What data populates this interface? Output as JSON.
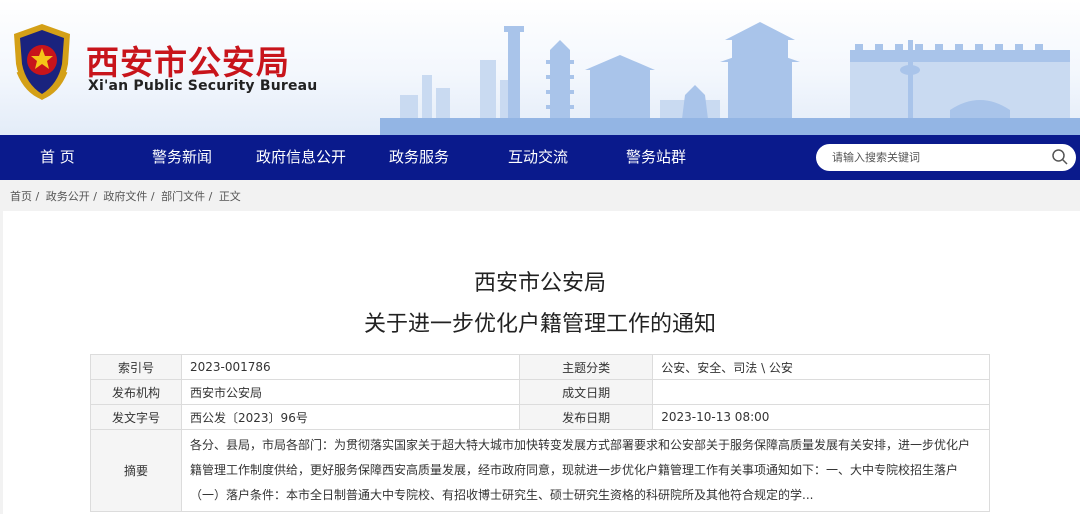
{
  "header": {
    "title_cn": "西安市公安局",
    "title_en": "Xi'an Public Security Bureau"
  },
  "nav": {
    "items": [
      "首 页",
      "警务新闻",
      "政府信息公开",
      "政务服务",
      "互动交流",
      "警务站群"
    ]
  },
  "search": {
    "placeholder": "请输入搜索关键词"
  },
  "breadcrumb": [
    "首页 /",
    "政务公开 /",
    "政府文件 /",
    "部门文件 /",
    "正文"
  ],
  "article": {
    "title_line1": "西安市公安局",
    "title_line2": "关于进一步优化户籍管理工作的通知"
  },
  "meta": {
    "index_label": "索引号",
    "index_value": "2023-001786",
    "topic_label": "主题分类",
    "topic_value": "公安、安全、司法 \\ 公安",
    "issuer_label": "发布机构",
    "issuer_value": "西安市公安局",
    "made_label": "成文日期",
    "made_value": "",
    "doc_label": "发文字号",
    "doc_value": "西公发〔2023〕96号",
    "pub_label": "发布日期",
    "pub_value": "2023-10-13 08:00",
    "abstract_label": "摘要",
    "abstract_value": "各分、县局，市局各部门：为贯彻落实国家关于超大特大城市加快转变发展方式部署要求和公安部关于服务保障高质量发展有关安排，进一步优化户籍管理工作制度供给，更好服务保障西安高质量发展，经市政府同意，现就进一步优化户籍管理工作有关事项通知如下：一、大中专院校招生落户（一）落户条件：本市全日制普通大中专院校、有招收博士研究生、硕士研究生资格的科研院所及其他符合规定的学..."
  },
  "colors": {
    "nav_bg": "#0a1a8c",
    "brand_red": "#c8141b"
  }
}
